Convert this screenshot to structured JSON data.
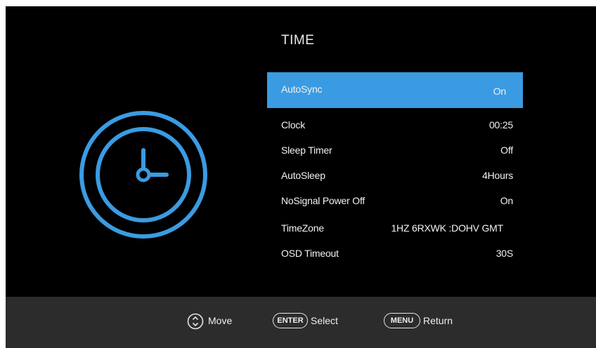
{
  "menu": {
    "title": "TIME",
    "items": [
      {
        "label": "AutoSync",
        "value": "On",
        "selected": true
      },
      {
        "label": "Clock",
        "value": "00:25",
        "selected": false
      },
      {
        "label": "Sleep  Timer",
        "value": "Off",
        "selected": false
      },
      {
        "label": "AutoSleep",
        "value": "4Hours",
        "selected": false
      },
      {
        "label": "NoSignal Power Off",
        "value": "On",
        "selected": false
      },
      {
        "label": "TimeZone",
        "value": "1HZ 6RXWK :DOHV GMT",
        "selected": false
      },
      {
        "label": "OSD  Timeout",
        "value": "30S",
        "selected": false
      }
    ]
  },
  "footer": {
    "move_label": "Move",
    "enter_key": "ENTER",
    "select_label": "Select",
    "menu_key": "MENU",
    "return_label": "Return"
  },
  "icons": {
    "page_icon": "clock-icon",
    "move_icon": "updown-arrows-icon"
  },
  "colors": {
    "accent": "#3b9be2",
    "background": "#000000",
    "footer": "#2c2c2c",
    "text": "#f2f2f2"
  }
}
